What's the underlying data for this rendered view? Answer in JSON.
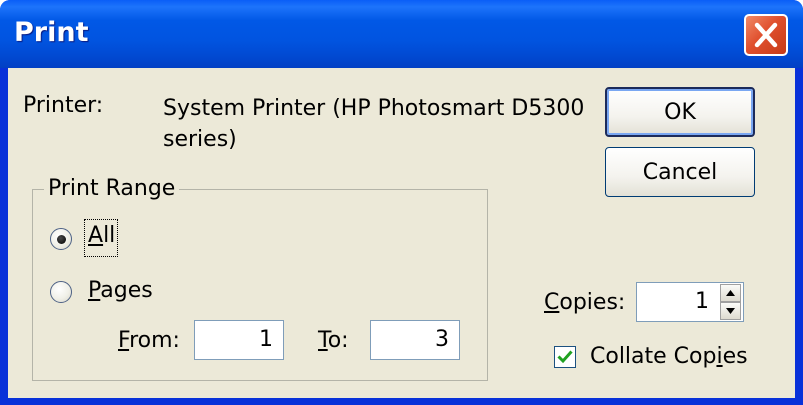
{
  "window": {
    "title": "Print"
  },
  "printer": {
    "label": "Printer:",
    "name_line1": "System Printer (HP Photosmart D5300",
    "name_line2": "series)"
  },
  "buttons": {
    "ok": "OK",
    "cancel": "Cancel"
  },
  "print_range": {
    "title": "Print Range",
    "all_label_mnemonic": "A",
    "all_label_rest": "ll",
    "all_selected": true,
    "pages_label_mnemonic": "P",
    "pages_label_rest": "ages",
    "pages_selected": false,
    "from_label_mnemonic": "F",
    "from_label_rest": "rom:",
    "from_value": "1",
    "to_label_mnemonic": "T",
    "to_label_rest": "o:",
    "to_value": "3"
  },
  "copies": {
    "label_mnemonic": "C",
    "label_rest": "opies:",
    "value": "1",
    "collate_label_prefix": "Collate Cop",
    "collate_label_mnemonic": "i",
    "collate_label_suffix": "es",
    "collate_checked": true
  },
  "icons": {
    "close": "close-icon",
    "spin_up": "arrow-up-icon",
    "spin_down": "arrow-down-icon",
    "check": "checkmark-icon"
  },
  "colors": {
    "titlebar": "#0054e3",
    "close_button": "#e0502e",
    "dialog_face": "#ece9d8"
  }
}
